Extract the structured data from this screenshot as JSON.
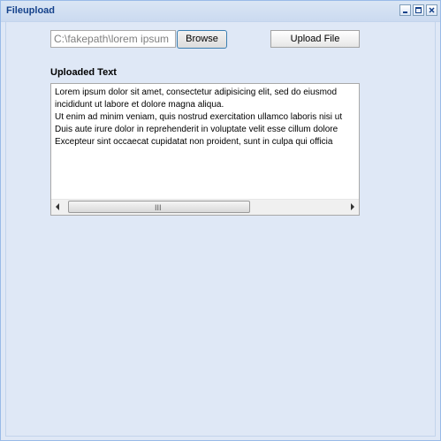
{
  "window": {
    "title": "Fileupload",
    "tools": [
      {
        "name": "minimize-icon"
      },
      {
        "name": "maximize-icon"
      },
      {
        "name": "close-icon"
      }
    ]
  },
  "form": {
    "file_value": "C:\\fakepath\\lorem ipsum",
    "browse_label": "Browse",
    "upload_label": "Upload File"
  },
  "uploaded": {
    "label": "Uploaded Text",
    "text": "Lorem ipsum dolor sit amet, consectetur adipisicing elit, sed do eiusmod\nincididunt ut labore et dolore magna aliqua.\nUt enim ad minim veniam, quis nostrud exercitation ullamco laboris nisi ut\nDuis aute irure dolor in reprehenderit in voluptate velit esse cillum dolore\nExcepteur sint occaecat cupidatat non proident, sunt in culpa qui officia",
    "scroll_grip": "III"
  },
  "colors": {
    "title_text": "#15428b",
    "panel_bg": "#dfe8f6",
    "border": "#99bbe8"
  }
}
